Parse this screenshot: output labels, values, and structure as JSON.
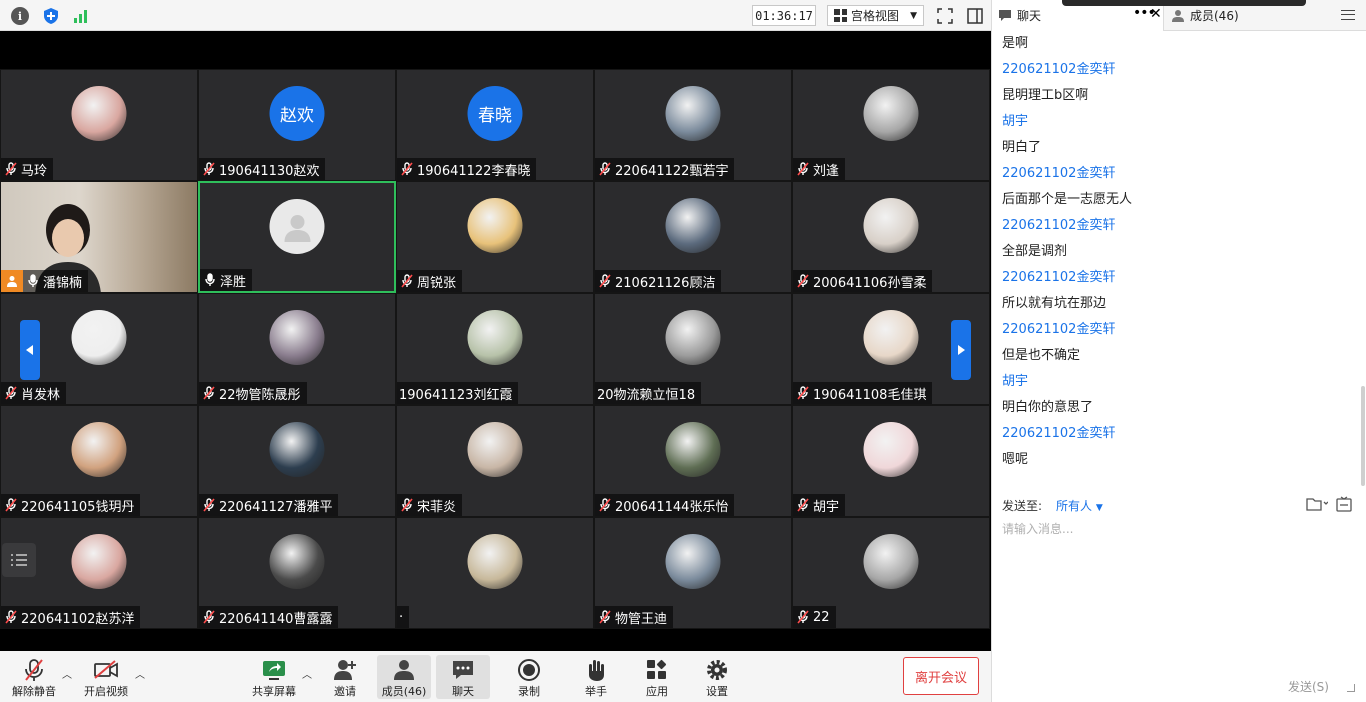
{
  "topbar": {
    "timer": "01:36:17",
    "view_label": "宫格视图"
  },
  "tiles": [
    {
      "name": "马玲",
      "avatar": "photo",
      "mic": "muted"
    },
    {
      "name": "190641130赵欢",
      "avatar": "text",
      "avatar_text": "赵欢",
      "mic": "muted"
    },
    {
      "name": "190641122李春晓",
      "avatar": "text",
      "avatar_text": "春晓",
      "mic": "muted"
    },
    {
      "name": "220641122甄若宇",
      "avatar": "photo",
      "mic": "muted"
    },
    {
      "name": "刘逢",
      "avatar": "photo",
      "mic": "muted"
    },
    {
      "name": "潘锦楠",
      "avatar": "camera",
      "mic": "on",
      "host": true
    },
    {
      "name": "泽胜",
      "avatar": "blank",
      "mic": "on",
      "active": true
    },
    {
      "name": "周锐张",
      "avatar": "photo",
      "mic": "muted"
    },
    {
      "name": "210621126顾洁",
      "avatar": "photo",
      "mic": "muted"
    },
    {
      "name": "200641106孙雪柔",
      "avatar": "photo",
      "mic": "muted"
    },
    {
      "name": "肖发林",
      "avatar": "photo",
      "mic": "muted"
    },
    {
      "name": "22物管陈晟彤",
      "avatar": "photo",
      "mic": "muted"
    },
    {
      "name": "190641123刘红霞",
      "avatar": "photo",
      "mic": "none"
    },
    {
      "name": "20物流赖立恒18",
      "avatar": "photo",
      "mic": "none"
    },
    {
      "name": "190641108毛佳琪",
      "avatar": "photo",
      "mic": "muted"
    },
    {
      "name": "220641105钱玥丹",
      "avatar": "photo",
      "mic": "muted"
    },
    {
      "name": "220641127潘雅平",
      "avatar": "photo",
      "mic": "muted"
    },
    {
      "name": "宋菲炎",
      "avatar": "photo",
      "mic": "muted"
    },
    {
      "name": "200641144张乐怡",
      "avatar": "photo",
      "mic": "muted"
    },
    {
      "name": "胡宇",
      "avatar": "photo",
      "mic": "muted"
    },
    {
      "name": "220641102赵苏洋",
      "avatar": "photo",
      "mic": "muted"
    },
    {
      "name": "220641140曹露露",
      "avatar": "photo",
      "mic": "muted"
    },
    {
      "name": "·",
      "avatar": "photo",
      "mic": "none"
    },
    {
      "name": "物管王迪",
      "avatar": "photo",
      "mic": "muted"
    },
    {
      "name": "22",
      "avatar": "photo",
      "mic": "muted"
    }
  ],
  "toolbar": {
    "unmute": "解除静音",
    "video": "开启视频",
    "share": "共享屏幕",
    "invite": "邀请",
    "members": "成员(46)",
    "chat": "聊天",
    "record": "录制",
    "raise_hand": "举手",
    "apps": "应用",
    "settings": "设置",
    "leave": "离开会议"
  },
  "panel": {
    "chat_tab": "聊天",
    "members_tab": "成员(46)",
    "messages": [
      {
        "type": "text",
        "content": "是啊"
      },
      {
        "type": "sender",
        "content": "220621102金奕轩"
      },
      {
        "type": "text",
        "content": "昆明理工b区啊"
      },
      {
        "type": "sender",
        "content": "胡宇"
      },
      {
        "type": "text",
        "content": "明白了"
      },
      {
        "type": "sender",
        "content": "220621102金奕轩"
      },
      {
        "type": "text",
        "content": "后面那个是一志愿无人"
      },
      {
        "type": "sender",
        "content": "220621102金奕轩"
      },
      {
        "type": "text",
        "content": "全部是调剂"
      },
      {
        "type": "sender",
        "content": "220621102金奕轩"
      },
      {
        "type": "text",
        "content": "所以就有坑在那边"
      },
      {
        "type": "sender",
        "content": "220621102金奕轩"
      },
      {
        "type": "text",
        "content": "但是也不确定"
      },
      {
        "type": "sender",
        "content": "胡宇"
      },
      {
        "type": "text",
        "content": "明白你的意思了"
      },
      {
        "type": "sender",
        "content": "220621102金奕轩"
      },
      {
        "type": "text",
        "content": "嗯呢"
      }
    ],
    "send_to_label": "发送至:",
    "send_to_value": "所有人",
    "input_placeholder": "请输入消息...",
    "send_button": "发送(S)"
  },
  "colors": {
    "accent": "#1a73e8",
    "active_border": "#2fbf5b",
    "leave": "#e04040",
    "host_badge": "#f08a24"
  }
}
